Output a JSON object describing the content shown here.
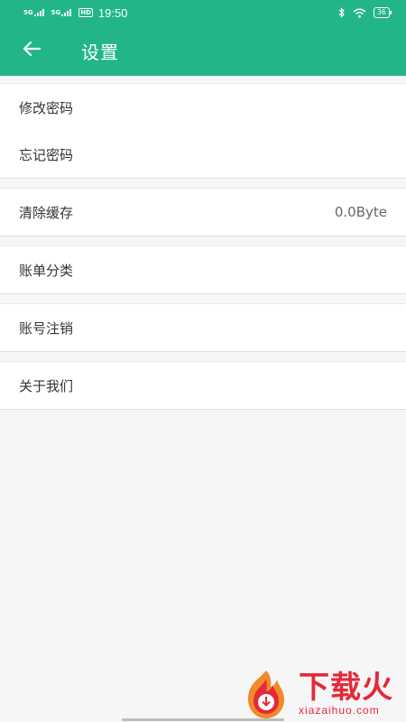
{
  "status_bar": {
    "sim1_label": "5G",
    "sim2_label": "5G",
    "hd_label": "HD",
    "time": "19:50",
    "battery": "36"
  },
  "header": {
    "title": "设置"
  },
  "groups": [
    {
      "items": [
        {
          "label": "修改密码"
        },
        {
          "label": "忘记密码"
        }
      ]
    },
    {
      "items": [
        {
          "label": "清除缓存",
          "value": "0.0Byte"
        }
      ]
    },
    {
      "items": [
        {
          "label": "账单分类"
        }
      ]
    },
    {
      "items": [
        {
          "label": "账号注销"
        }
      ]
    },
    {
      "items": [
        {
          "label": "关于我们"
        }
      ]
    }
  ],
  "watermark": {
    "cn": "下载火",
    "en": "xiazaihuo.com"
  },
  "colors": {
    "accent": "#22b58a",
    "watermark": "#e5283a"
  }
}
